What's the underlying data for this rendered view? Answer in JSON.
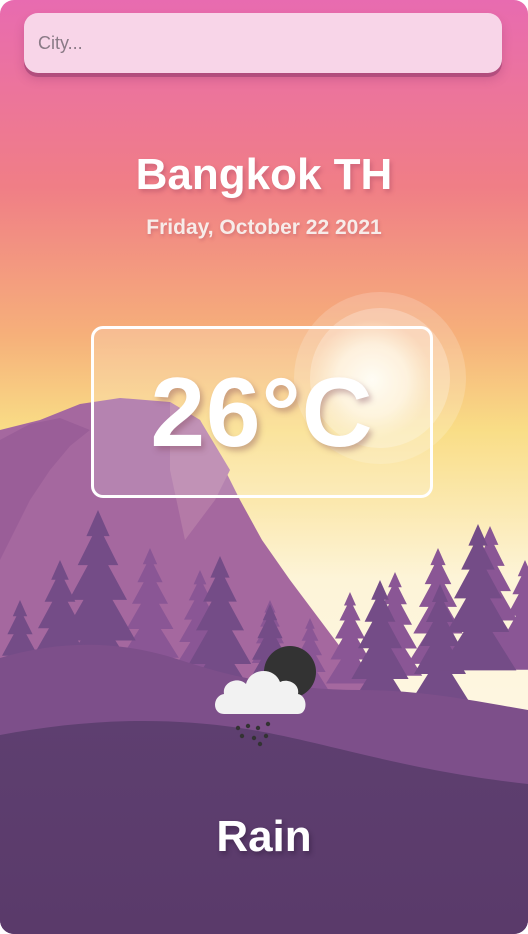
{
  "search": {
    "placeholder": "City..."
  },
  "location": {
    "city": "Bangkok",
    "country": "TH",
    "label": "Bangkok TH"
  },
  "date": "Friday, October 22 2021",
  "temperature": "26°C",
  "condition": "Rain",
  "weather_icon": "rain-cloud-moon-icon",
  "colors": {
    "sky_top": "#e96aa8",
    "sky_mid": "#f08a7c",
    "sky_horizon": "#f9e08a",
    "mountain": "#9b5f9a",
    "forest": "#6f4a85",
    "ground": "#5a3d6b"
  }
}
